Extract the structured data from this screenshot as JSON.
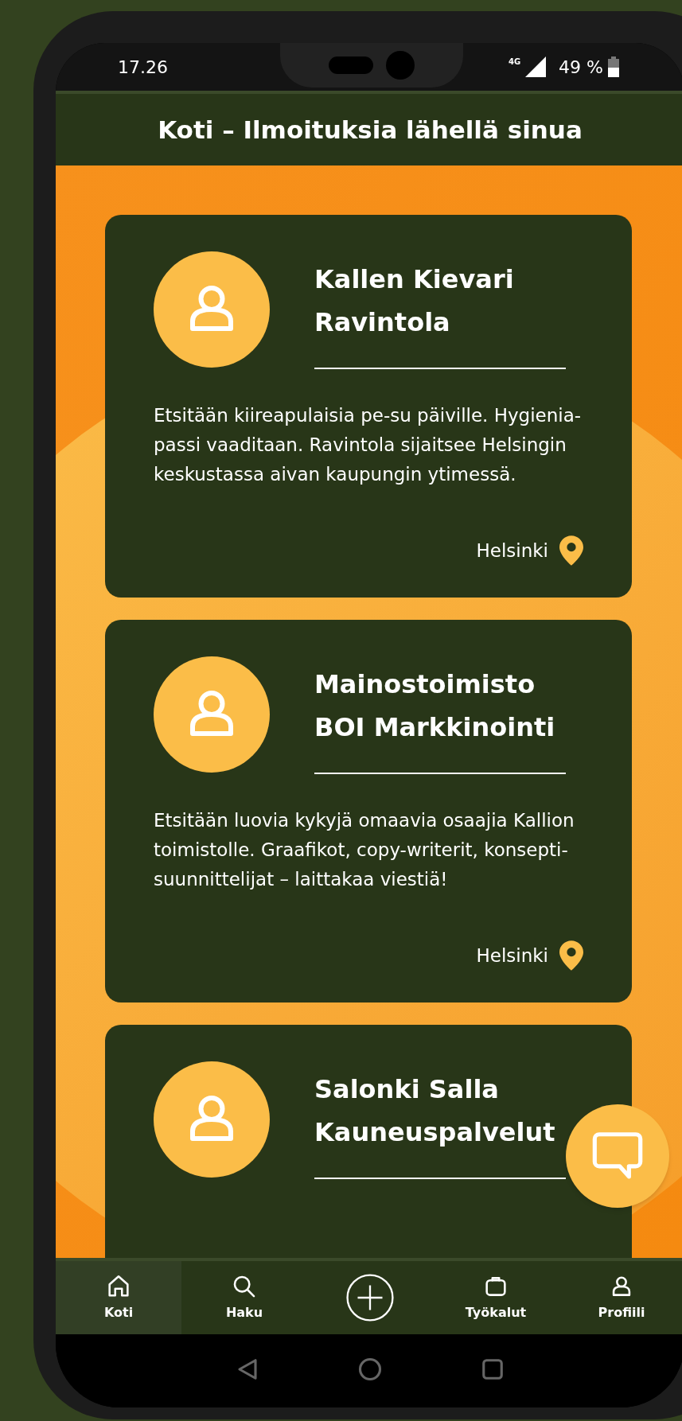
{
  "status_bar": {
    "time": "17.26",
    "network": "4G",
    "battery": "49 %"
  },
  "header": {
    "title": "Koti – Ilmoituksia lähellä sinua"
  },
  "listings": [
    {
      "title": "Kallen Kievari Ravintola",
      "description": "Etsitään kiireapulaisia pe-su päiville. Hygienia-passi vaaditaan. Ravintola sijaitsee Helsingin keskustassa aivan kaupungin ytimessä.",
      "location": "Helsinki"
    },
    {
      "title": "Mainostoimisto BOI Markkinointi",
      "description": "Etsitään luovia kykyjä omaavia osaajia Kallion toimistolle. Graafikot, copy-writerit, konsepti-suunnittelijat – laittakaa viestiä!",
      "location": "Helsinki"
    },
    {
      "title": "Salonki Salla Kauneuspalvelut"
    }
  ],
  "bottom_nav": [
    {
      "kind": "home",
      "label": "Koti",
      "selected": true
    },
    {
      "kind": "search",
      "label": "Haku",
      "selected": false
    },
    {
      "kind": "add",
      "selected": false
    },
    {
      "kind": "tools",
      "label": "Työkalut",
      "selected": false
    },
    {
      "kind": "profile",
      "label": "Profiili",
      "selected": false
    }
  ]
}
